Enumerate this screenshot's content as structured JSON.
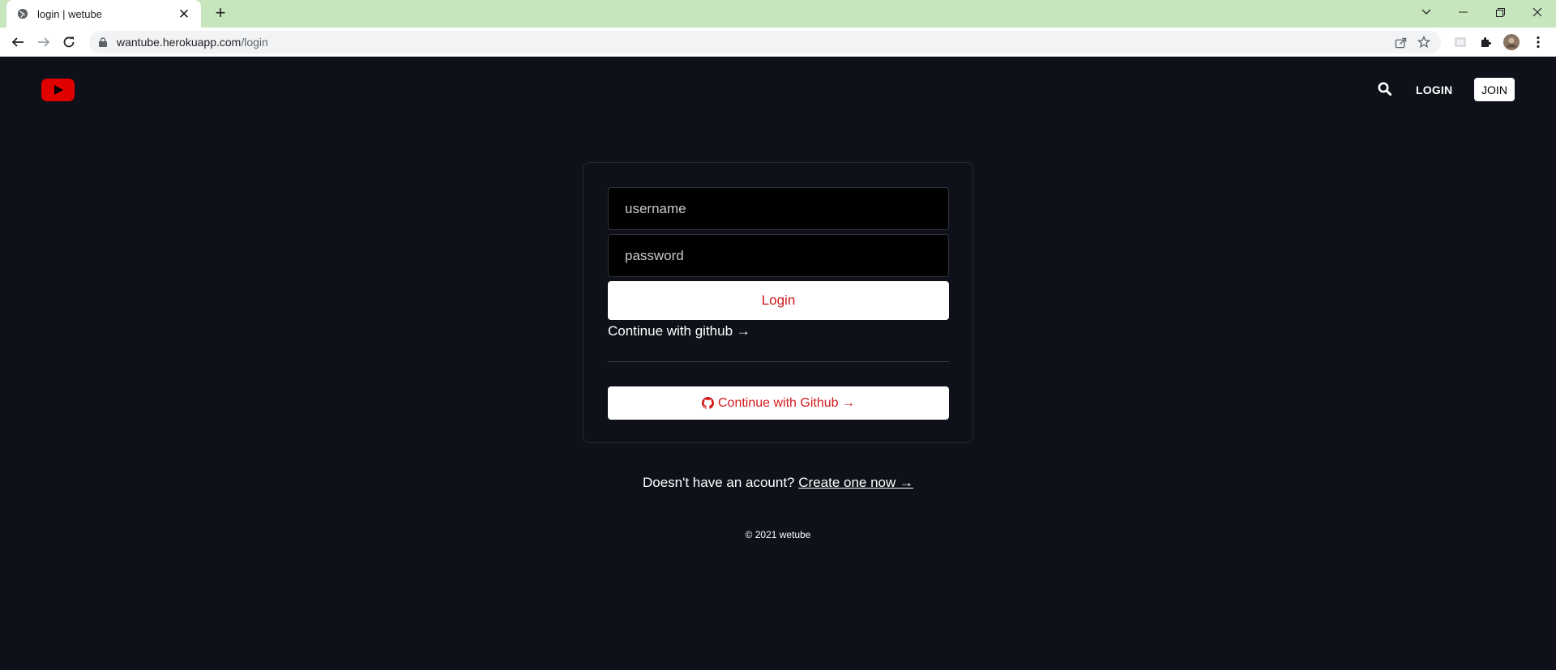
{
  "browser": {
    "tab_title": "login | wetube",
    "url_host": "wantube.herokuapp.com",
    "url_path": "/login"
  },
  "header": {
    "login_label": "LOGIN",
    "join_label": "JOIN"
  },
  "form": {
    "username_placeholder": "username",
    "password_placeholder": "password",
    "login_button": "Login",
    "github_link": "Continue with github →",
    "github_button": "Continue with Github →"
  },
  "signup": {
    "prompt": "Doesn't have an acount?",
    "link": "Create one now →"
  },
  "footer": {
    "copyright": "© 2021 wetube"
  },
  "colors": {
    "background": "#0e1119",
    "brand_red": "#e10000",
    "accent_red": "#d2191a",
    "tab_strip": "#c8e6be"
  },
  "icons": [
    "globe-icon",
    "close-icon",
    "plus-icon",
    "chevron-down-icon",
    "minimize-icon",
    "restore-icon",
    "window-close-icon",
    "back-arrow-icon",
    "forward-arrow-icon",
    "reload-icon",
    "lock-icon",
    "share-icon",
    "star-icon",
    "extension-placeholder-icon",
    "puzzle-icon",
    "profile-avatar-icon",
    "kebab-menu-icon",
    "play-logo-icon",
    "search-icon",
    "github-icon"
  ]
}
